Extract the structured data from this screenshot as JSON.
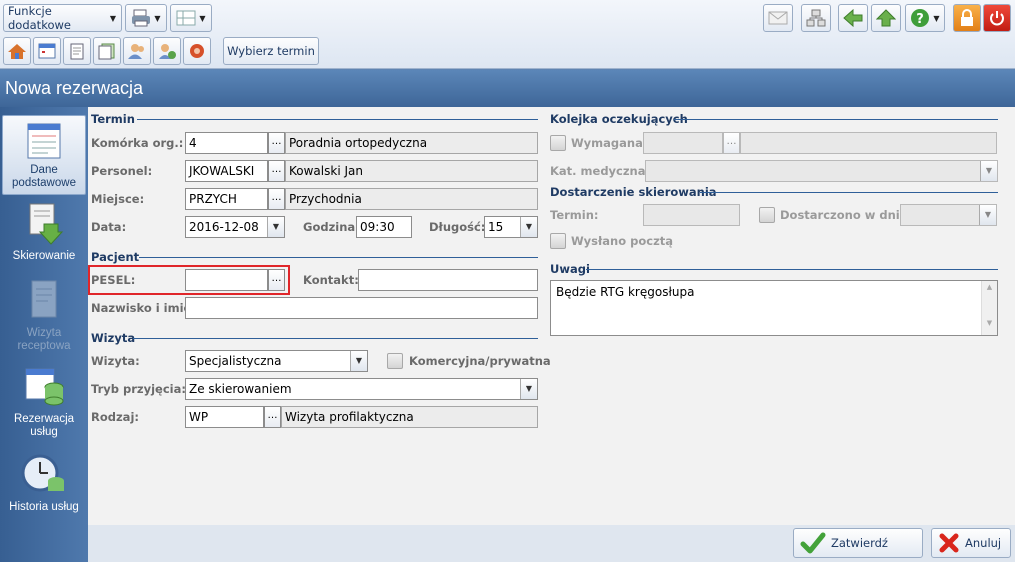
{
  "toolbar": {
    "functions_label": "Funkcje dodatkowe",
    "choose_term_label": "Wybierz termin"
  },
  "window": {
    "title": "Nowa rezerwacja"
  },
  "sidebar": {
    "items": [
      {
        "label": "Dane podstawowe"
      },
      {
        "label": "Skierowanie"
      },
      {
        "label": "Wizyta receptowa"
      },
      {
        "label": "Rezerwacja usług"
      },
      {
        "label": "Historia usług"
      }
    ]
  },
  "termin": {
    "section": "Termin",
    "org_label": "Komórka org.:",
    "org_code": "4",
    "org_name": "Poradnia ortopedyczna",
    "staff_label": "Personel:",
    "staff_code": "JKOWALSKI",
    "staff_name": "Kowalski Jan",
    "place_label": "Miejsce:",
    "place_code": "PRZYCH",
    "place_name": "Przychodnia",
    "date_label": "Data:",
    "date_value": "2016-12-08",
    "time_label": "Godzina:",
    "time_value": "09:30",
    "length_label": "Długość:",
    "length_value": "15"
  },
  "patient": {
    "section": "Pacjent",
    "pesel_label": "PESEL:",
    "pesel_value": "",
    "contact_label": "Kontakt:",
    "contact_value": "",
    "name_label": "Nazwisko i imię:",
    "name_value": ""
  },
  "visit": {
    "section": "Wizyta",
    "visit_label": "Wizyta:",
    "visit_value": "Specjalistyczna",
    "commercial_label": "Komercyjna/prywatna",
    "mode_label": "Tryb przyjęcia:",
    "mode_value": "Ze skierowaniem",
    "kind_label": "Rodzaj:",
    "kind_code": "WP",
    "kind_name": "Wizyta profilaktyczna"
  },
  "queue": {
    "section": "Kolejka oczekujących",
    "required_label": "Wymagana",
    "category_label": "Kat. medyczna:"
  },
  "referral": {
    "section": "Dostarczenie skierowania",
    "term_label": "Termin:",
    "delivered_label": "Dostarczono w dniu:",
    "mailed_label": "Wysłano pocztą"
  },
  "notes": {
    "section": "Uwagi",
    "text": "Będzie RTG kręgosłupa"
  },
  "actions": {
    "confirm_label": "Zatwierdź",
    "cancel_label": "Anuluj"
  },
  "colors": {
    "accent": "#3e6698",
    "highlight": "#e0262a"
  }
}
